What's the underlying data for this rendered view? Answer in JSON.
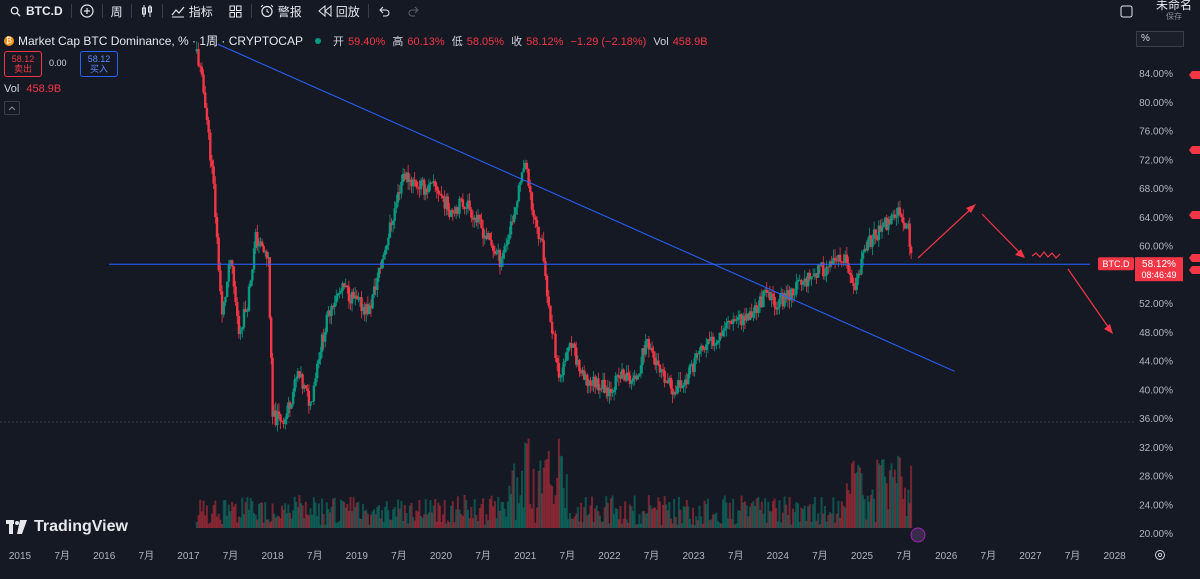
{
  "toolbar": {
    "symbol": "BTC.D",
    "interval": "周",
    "indicators": "指标",
    "alert": "警报",
    "replay": "回放",
    "unnamed": "未命名",
    "save": "保存"
  },
  "legend": {
    "title": "Market Cap BTC Dominance, % · 1周 · CRYPTOCAP",
    "open_label": "开",
    "open": "59.40%",
    "high_label": "高",
    "high": "60.13%",
    "low_label": "低",
    "low": "58.05%",
    "close_label": "收",
    "close": "58.12%",
    "change": "−1.29 (−2.18%)",
    "vol_label": "Vol",
    "vol_value": "458.9B"
  },
  "trade": {
    "sell_price": "58.12",
    "sell_label": "卖出",
    "spread": "0.00",
    "buy_price": "58.12",
    "buy_label": "买入"
  },
  "vol_row": {
    "label": "Vol",
    "value": "458.9B"
  },
  "scale_unit": "%",
  "price_label": {
    "symbol": "BTC.D",
    "price": "58.12%",
    "countdown": "08:46:49"
  },
  "logo_text": "TradingView",
  "colors": {
    "up": "#089981",
    "down": "#f23645",
    "trend": "#2962ff",
    "arrow": "#f23645",
    "bg": "#151924"
  },
  "chart_data": {
    "type": "candlestick",
    "title": "Market Cap BTC Dominance, % · 1周 · CRYPTOCAP",
    "y_axis_ticks": [
      "84.00%",
      "80.00%",
      "76.00%",
      "72.00%",
      "68.00%",
      "64.00%",
      "60.00%",
      "56.00%",
      "52.00%",
      "48.00%",
      "44.00%",
      "40.00%",
      "36.00%",
      "32.00%",
      "28.00%",
      "24.00%",
      "20.00%"
    ],
    "x_axis_ticks": [
      "2015",
      "7月",
      "2016",
      "7月",
      "2017",
      "7月",
      "2018",
      "7月",
      "2019",
      "7月",
      "2020",
      "7月",
      "2021",
      "7月",
      "2022",
      "7月",
      "2023",
      "7月",
      "2024",
      "7月",
      "2025",
      "7月",
      "2026",
      "7月",
      "2027",
      "7月",
      "2028"
    ],
    "series": [
      {
        "name": "BTC.D",
        "points": [
          {
            "t": 2017.1,
            "v": 87
          },
          {
            "t": 2017.2,
            "v": 80
          },
          {
            "t": 2017.3,
            "v": 68
          },
          {
            "t": 2017.4,
            "v": 50
          },
          {
            "t": 2017.5,
            "v": 58
          },
          {
            "t": 2017.6,
            "v": 48
          },
          {
            "t": 2017.7,
            "v": 52
          },
          {
            "t": 2017.8,
            "v": 61
          },
          {
            "t": 2017.95,
            "v": 58
          },
          {
            "t": 2018.0,
            "v": 36
          },
          {
            "t": 2018.15,
            "v": 36
          },
          {
            "t": 2018.3,
            "v": 42
          },
          {
            "t": 2018.45,
            "v": 38
          },
          {
            "t": 2018.55,
            "v": 45
          },
          {
            "t": 2018.7,
            "v": 52
          },
          {
            "t": 2018.85,
            "v": 54
          },
          {
            "t": 2019.0,
            "v": 52
          },
          {
            "t": 2019.15,
            "v": 51
          },
          {
            "t": 2019.3,
            "v": 58
          },
          {
            "t": 2019.45,
            "v": 65
          },
          {
            "t": 2019.55,
            "v": 70
          },
          {
            "t": 2019.65,
            "v": 69
          },
          {
            "t": 2019.8,
            "v": 68
          },
          {
            "t": 2019.95,
            "v": 68
          },
          {
            "t": 2020.1,
            "v": 65
          },
          {
            "t": 2020.3,
            "v": 66
          },
          {
            "t": 2020.5,
            "v": 62
          },
          {
            "t": 2020.7,
            "v": 58
          },
          {
            "t": 2020.85,
            "v": 63
          },
          {
            "t": 2021.0,
            "v": 72
          },
          {
            "t": 2021.1,
            "v": 64
          },
          {
            "t": 2021.2,
            "v": 60
          },
          {
            "t": 2021.3,
            "v": 50
          },
          {
            "t": 2021.4,
            "v": 42
          },
          {
            "t": 2021.55,
            "v": 46
          },
          {
            "t": 2021.7,
            "v": 41
          },
          {
            "t": 2021.85,
            "v": 41
          },
          {
            "t": 2022.0,
            "v": 40
          },
          {
            "t": 2022.15,
            "v": 42
          },
          {
            "t": 2022.3,
            "v": 41
          },
          {
            "t": 2022.45,
            "v": 47
          },
          {
            "t": 2022.6,
            "v": 42
          },
          {
            "t": 2022.75,
            "v": 40
          },
          {
            "t": 2022.9,
            "v": 41
          },
          {
            "t": 2023.05,
            "v": 45
          },
          {
            "t": 2023.25,
            "v": 47
          },
          {
            "t": 2023.45,
            "v": 50
          },
          {
            "t": 2023.65,
            "v": 50
          },
          {
            "t": 2023.85,
            "v": 53
          },
          {
            "t": 2024.0,
            "v": 52
          },
          {
            "t": 2024.2,
            "v": 54
          },
          {
            "t": 2024.4,
            "v": 56
          },
          {
            "t": 2024.6,
            "v": 57
          },
          {
            "t": 2024.8,
            "v": 58
          },
          {
            "t": 2024.9,
            "v": 54
          },
          {
            "t": 2025.05,
            "v": 60
          },
          {
            "t": 2025.2,
            "v": 62
          },
          {
            "t": 2025.35,
            "v": 64
          },
          {
            "t": 2025.45,
            "v": 65
          },
          {
            "t": 2025.55,
            "v": 62
          },
          {
            "t": 2025.6,
            "v": 58
          }
        ]
      }
    ],
    "horizontal_line": {
      "v": 57.4
    },
    "trendline": {
      "from": {
        "t": 2017.35,
        "v": 88
      },
      "to": {
        "t": 2026.1,
        "v": 42.5
      }
    },
    "annotations": [
      "arrow up",
      "arrow down",
      "scribble",
      "arrow down"
    ],
    "ylim": [
      18,
      88
    ],
    "xlim": [
      2014.8,
      2028.4
    ]
  }
}
